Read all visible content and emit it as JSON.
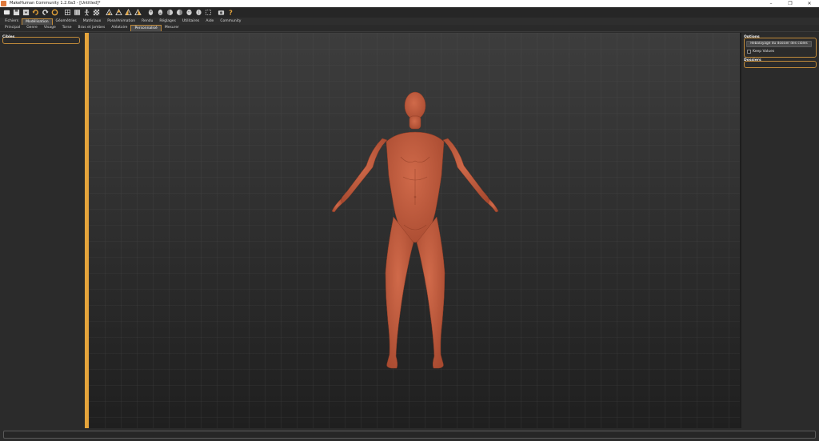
{
  "window": {
    "title": "MakeHuman Community 1.2.0a3 - [Untitled]*",
    "minimize": "–",
    "maximize": "❐",
    "close": "✕"
  },
  "toolbar": {
    "icons": [
      "window-icon",
      "save-icon",
      "load-icon",
      "undo-icon",
      "redo-icon",
      "reset-icon",
      "wireframe-icon",
      "pose-icon",
      "skeleton-icon",
      "checker-icon",
      "front-view-icon",
      "back-view-icon",
      "side-view-icon",
      "left-view-icon",
      "top-view-icon",
      "bottom-view-icon",
      "persp-icon",
      "global-view-icon",
      "face-view-icon",
      "grid-icon",
      "screenshot-icon",
      "help-icon"
    ]
  },
  "main_tabs": [
    "Fichiers",
    "Modélisation",
    "Géométries",
    "Matériaux",
    "Pose/Animation",
    "Rendu",
    "Réglages",
    "Utilitaires",
    "Aide",
    "Community"
  ],
  "main_tabs_active": "Modélisation",
  "sub_tabs": [
    "Principal",
    "Genre",
    "Visage",
    "Torse",
    "Bras et jambes",
    "Aléatoire",
    "Personnalisé",
    "Mesurer"
  ],
  "sub_tabs_active": "Personnalisé",
  "left_panel": {
    "cibles_title": "Cibles"
  },
  "right_panel": {
    "options_title": "Options",
    "rescan_button": "Rebalayage du dossier des cibles",
    "keep_values_label": "Keep Values",
    "keep_values_checked": false,
    "dossiers_title": "Dossiers"
  },
  "colors": {
    "accent": "#e5a43b",
    "skin": "#c45a3c",
    "panel_bg": "#2b2b2b"
  }
}
